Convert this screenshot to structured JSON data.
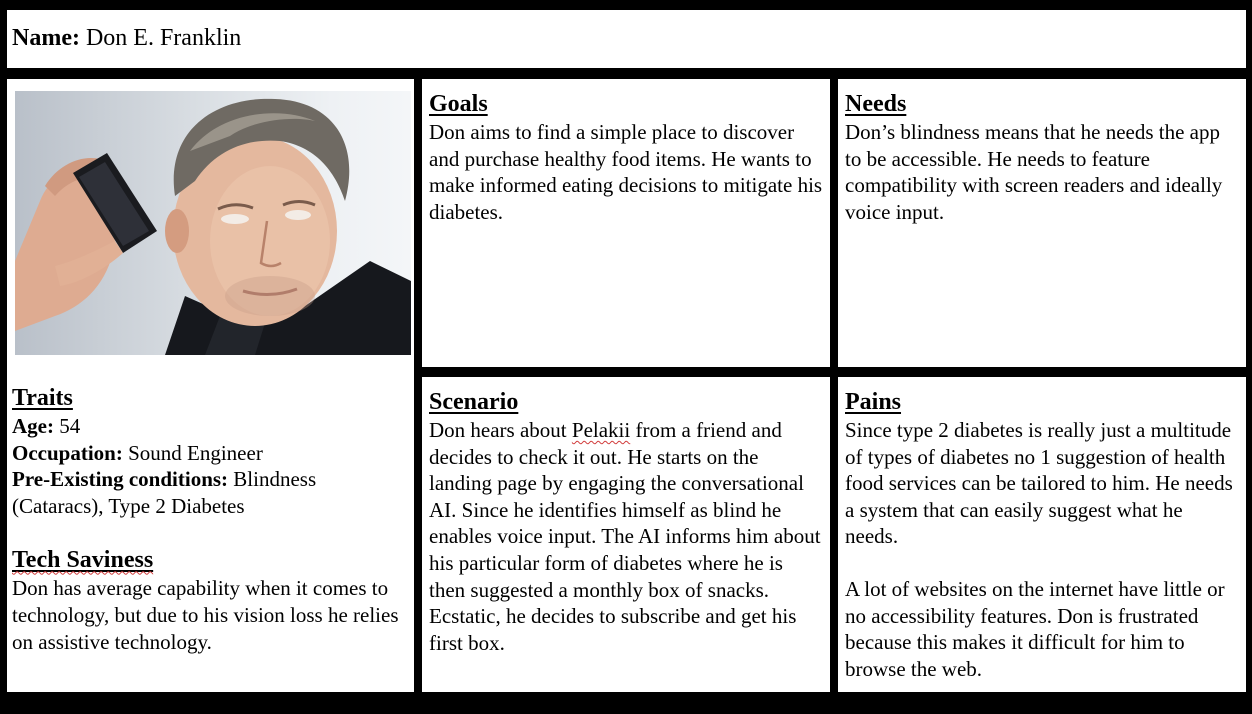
{
  "header": {
    "name_label": "Name:",
    "name_value": "Don E. Franklin"
  },
  "traits": {
    "heading": "Traits",
    "age_label": "Age:",
    "age_value": "54",
    "occupation_label": "Occupation:",
    "occupation_value": "Sound Engineer",
    "conditions_label": "Pre-Existing conditions:",
    "conditions_value_line1": "Blindness",
    "conditions_value_line2": "(Cataracs), Type 2 Diabetes"
  },
  "tech": {
    "heading": "Tech Saviness",
    "text": "Don has average capability when it comes to technology, but due to his vision loss he relies on assistive technology."
  },
  "goals": {
    "heading": "Goals",
    "text": "Don aims to find a simple place to discover and purchase healthy food items. He wants to make informed eating decisions to mitigate his diabetes."
  },
  "needs": {
    "heading": "Needs",
    "text": "Don’s blindness means that he needs the app to be accessible. He needs to feature compatibility with screen readers and ideally voice input."
  },
  "scenario": {
    "heading": "Scenario",
    "text_before": "Don hears about ",
    "app_name": "Pelakii",
    "text_after": " from a friend and decides to check it out. He starts on the landing page by engaging the conversational AI. Since he identifies himself as blind he enables voice input. The AI informs him about his particular form of diabetes where he is then suggested a monthly box of snacks. Ecstatic, he decides to subscribe and get his first box."
  },
  "pains": {
    "heading": "Pains",
    "paragraph1": "Since type 2 diabetes is really just a multitude of types of diabetes no 1 suggestion of health food services can be tailored to him. He needs a system that can easily suggest what he needs.",
    "paragraph2": "A lot of websites on the internet have little or no accessibility features. Don is frustrated because this makes it difficult for him to browse the web."
  },
  "photo": {
    "icon": "persona-photo"
  }
}
